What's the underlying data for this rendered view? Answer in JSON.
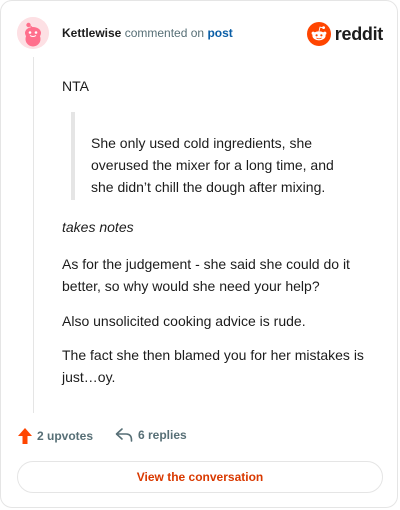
{
  "header": {
    "username": "Kettlewise",
    "action_text": "commented on",
    "post_link_label": "post",
    "brand_label": "reddit"
  },
  "comment": {
    "paragraph_nta": "NTA",
    "quote": "She only used cold ingredients, she overused the mixer for a long time, and she didn’t chill the dough after mixing.",
    "paragraph_notes": "takes notes",
    "paragraph_judgement": "As for the judgement - she said she could do it better, so why would she need your help?",
    "paragraph_advice": "Also unsolicited cooking advice is rude.",
    "paragraph_mistakes": "The fact she then blamed you for her mistakes is just…oy."
  },
  "footer": {
    "upvotes_label": "2 upvotes",
    "replies_label": "6 replies",
    "view_conversation_label": "View the conversation"
  },
  "colors": {
    "accent_orange": "#ff4500",
    "link_blue": "#0a5ea6",
    "cta_text": "#d93900",
    "muted_text": "#576f76",
    "avatar_bg": "#fde0e4",
    "avatar_alien": "#ff6f8c"
  },
  "icons": {
    "avatar": "snoo-avatar-icon",
    "brand": "reddit-logo-icon",
    "upvote": "upvote-arrow-icon",
    "reply": "reply-arrow-icon"
  }
}
